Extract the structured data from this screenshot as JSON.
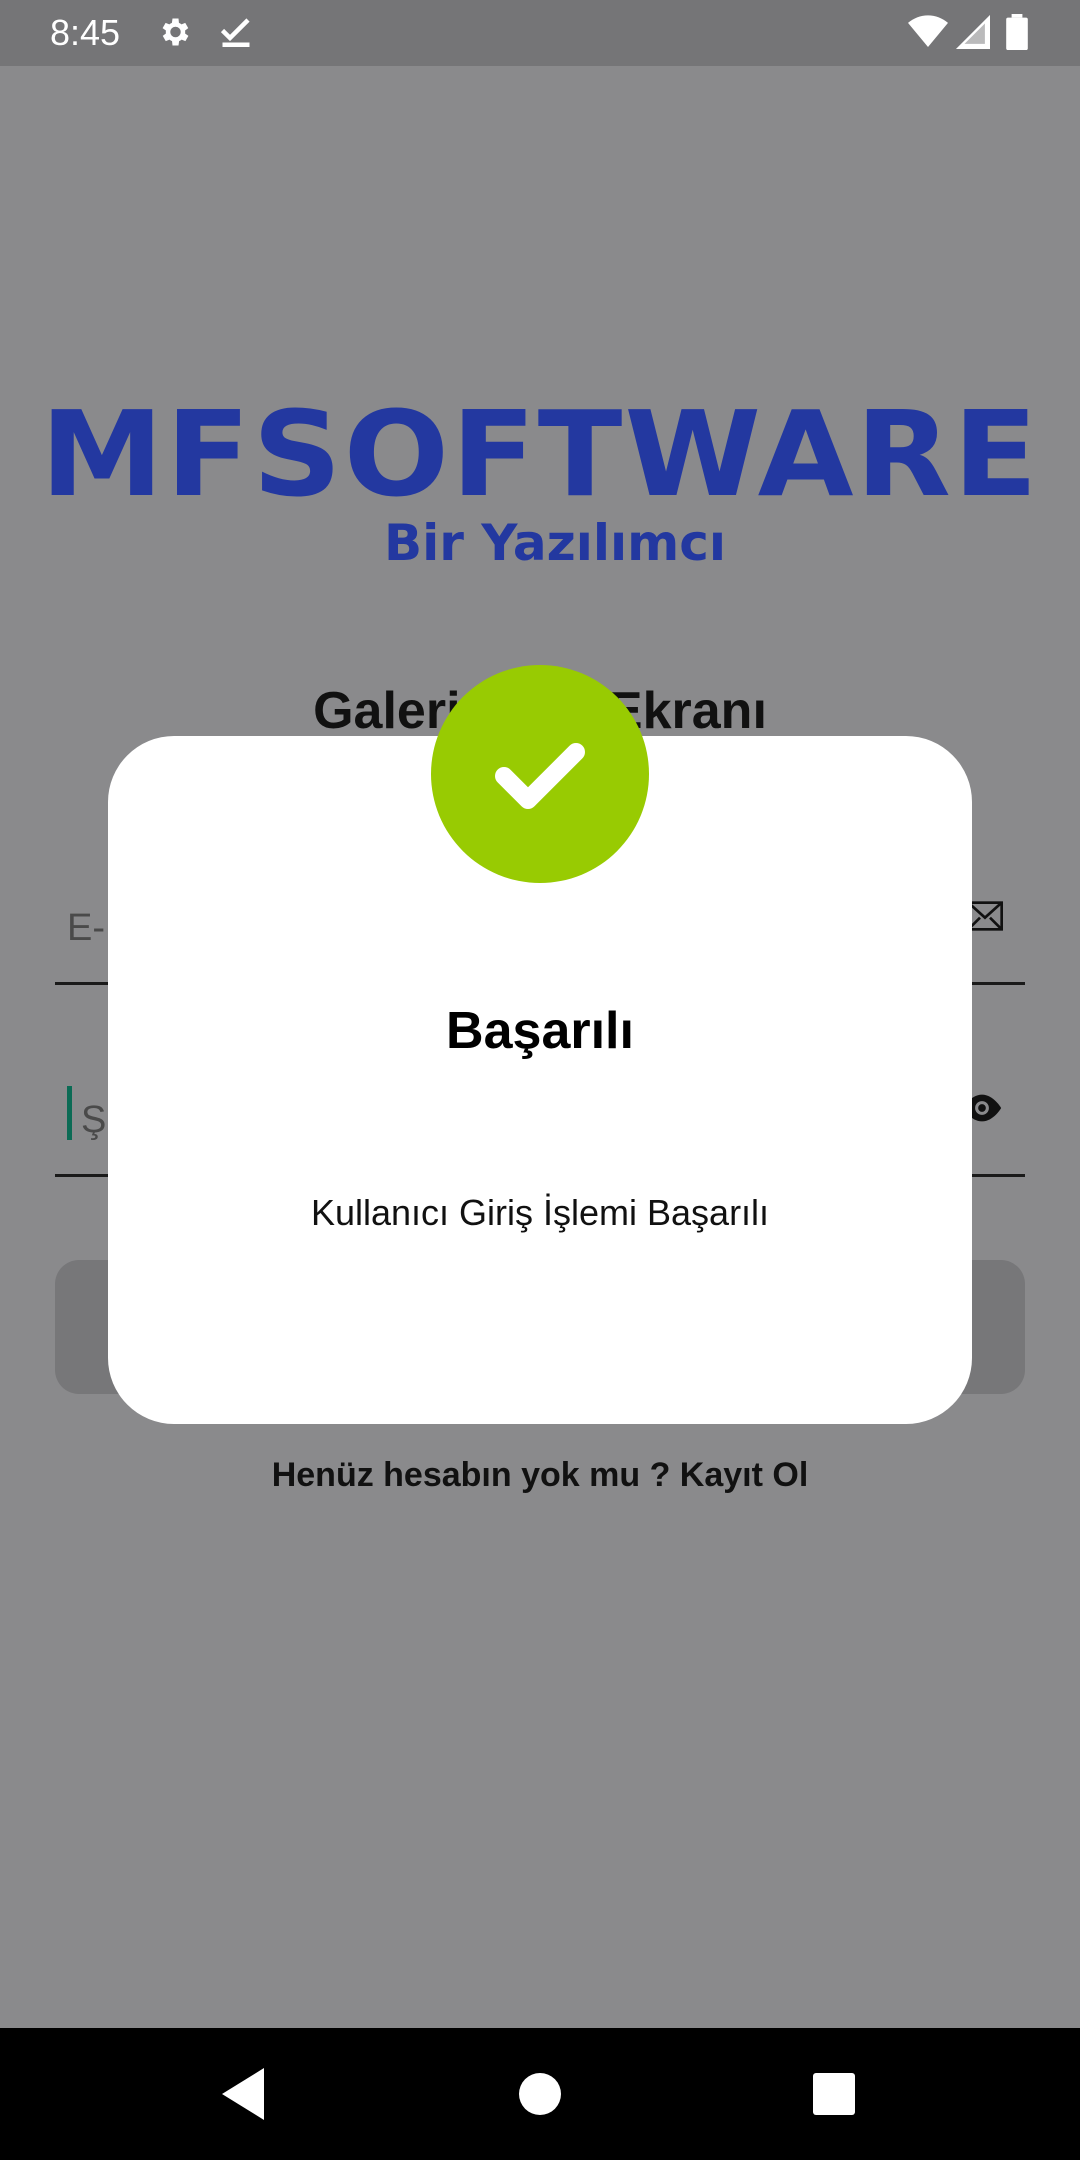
{
  "status_bar": {
    "time": "8:45",
    "icons": [
      "settings-icon",
      "checkmark-download-icon",
      "wifi-icon",
      "signal-icon",
      "battery-icon"
    ]
  },
  "logo": {
    "main_text": "MFSOFTWARE",
    "tagline": "Bir Yazılımcı",
    "color": "#2338a0"
  },
  "screen": {
    "title": "Galeri Giriş Ekranı",
    "email_placeholder": "E-Mail",
    "password_placeholder": "Şifre",
    "signup_text": "Henüz hesabın yok mu ? Kayıt Ol"
  },
  "dialog": {
    "title": "Başarılı",
    "message": "Kullanıcı Giriş İşlemi Başarılı",
    "badge_color": "#98cb02",
    "icon": "checkmark-icon"
  },
  "nav_bar": {
    "buttons": [
      "back-icon",
      "home-icon",
      "recents-icon"
    ]
  }
}
